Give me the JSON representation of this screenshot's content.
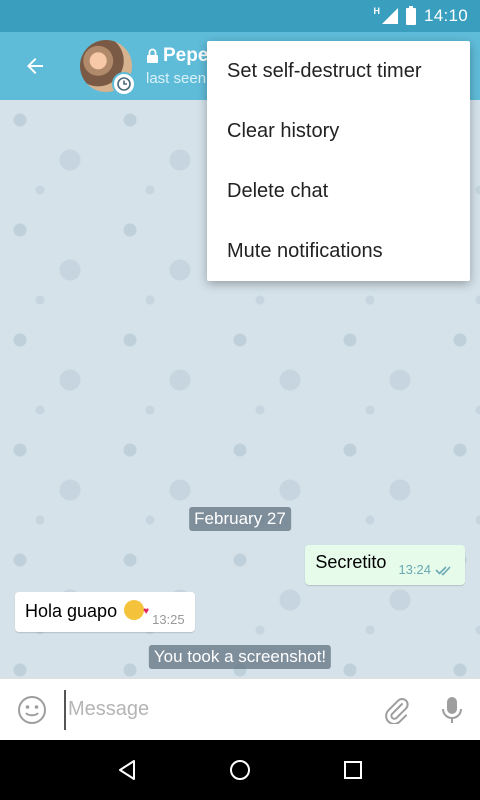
{
  "status_bar": {
    "network_type": "H",
    "time": "14:10"
  },
  "header": {
    "chat_name": "Pepe",
    "status": "last seen",
    "icons": [
      "back-arrow-icon",
      "lock-icon",
      "timer-icon"
    ]
  },
  "menu": {
    "items": [
      {
        "label": "Set self-destruct timer"
      },
      {
        "label": "Clear history"
      },
      {
        "label": "Delete chat"
      },
      {
        "label": "Mute notifications"
      }
    ]
  },
  "chat": {
    "date_separator": "February 27",
    "messages": [
      {
        "direction": "outgoing",
        "text": "Secretito",
        "time": "13:24",
        "read": true
      },
      {
        "direction": "incoming",
        "text": "Hola guapo",
        "emoji": "kissing-face-with-heart",
        "time": "13:25"
      }
    ],
    "service_message": "You took a screenshot!"
  },
  "input": {
    "placeholder": "Message",
    "value": ""
  },
  "colors": {
    "header": "#5fbcd9",
    "status_bar": "#3a9fbf",
    "outgoing_bubble": "#e6fbe9",
    "chat_background": "#d5e2ea",
    "read_check": "#6aa9b3"
  }
}
